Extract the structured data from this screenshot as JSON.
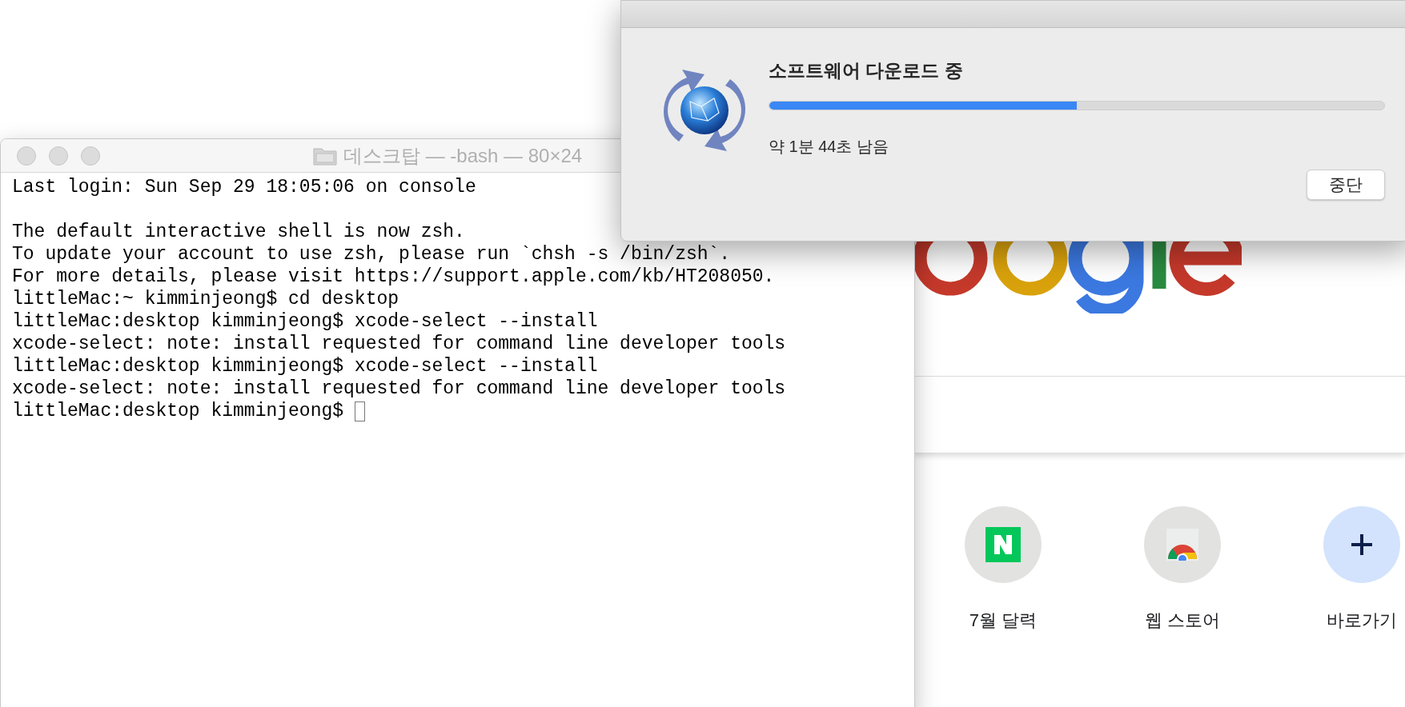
{
  "browser": {
    "shortcuts": [
      {
        "kind": "naver",
        "label": "7월 달력"
      },
      {
        "kind": "webstore",
        "label": "웹 스토어"
      },
      {
        "kind": "add",
        "label": "바로가기"
      }
    ]
  },
  "terminal": {
    "title": "데스크탑 — -bash — 80×24",
    "blocks": [
      [
        "Last login: Sun Sep 29 18:05:06 on console"
      ],
      [
        "The default interactive shell is now zsh.",
        "To update your account to use zsh, please run `chsh -s /bin/zsh`.",
        "For more details, please visit https://support.apple.com/kb/HT208050.",
        "littleMac:~ kimminjeong$ cd desktop",
        "littleMac:desktop kimminjeong$ xcode-select --install",
        "xcode-select: note: install requested for command line developer tools",
        "littleMac:desktop kimminjeong$ xcode-select --install",
        "xcode-select: note: install requested for command line developer tools",
        "littleMac:desktop kimminjeong$ "
      ]
    ],
    "cursor": true
  },
  "dialog": {
    "title": "소프트웨어 다운로드 중",
    "progress": {
      "level": 0.5
    },
    "status": "약 1분 44초 남음",
    "button": "중단"
  }
}
